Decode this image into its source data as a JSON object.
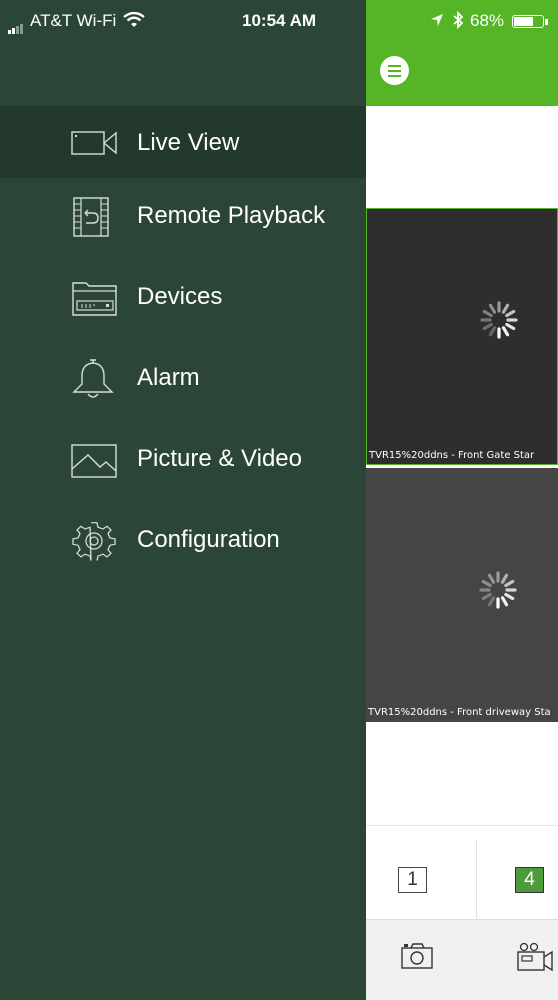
{
  "status_bar": {
    "carrier": "AT&T Wi-Fi",
    "time": "10:54 AM",
    "battery": "68%",
    "battery_level": 0.68
  },
  "drawer": {
    "items": [
      {
        "label": "Live View",
        "icon": "camera-icon",
        "active": true
      },
      {
        "label": "Remote Playback",
        "icon": "playback-icon",
        "active": false
      },
      {
        "label": "Devices",
        "icon": "devices-icon",
        "active": false
      },
      {
        "label": "Alarm",
        "icon": "bell-icon",
        "active": false
      },
      {
        "label": "Picture & Video",
        "icon": "picture-icon",
        "active": false
      },
      {
        "label": "Configuration",
        "icon": "gear-icon",
        "active": false
      }
    ]
  },
  "live_view": {
    "menu_icon": "menu-icon",
    "cameras": [
      {
        "label": "TVR15%20ddns - Front Gate Star",
        "state": "loading"
      },
      {
        "label": "TVR15%20ddns - Front driveway Sta",
        "state": "loading"
      }
    ],
    "split_options": [
      {
        "label": "1",
        "selected": false
      },
      {
        "label": "4",
        "selected": true
      }
    ],
    "toolbar": [
      "snapshot-icon",
      "record-icon"
    ]
  },
  "colors": {
    "accent": "#55b527",
    "drawer": "#2b4636",
    "drawer_active": "#22392b"
  }
}
